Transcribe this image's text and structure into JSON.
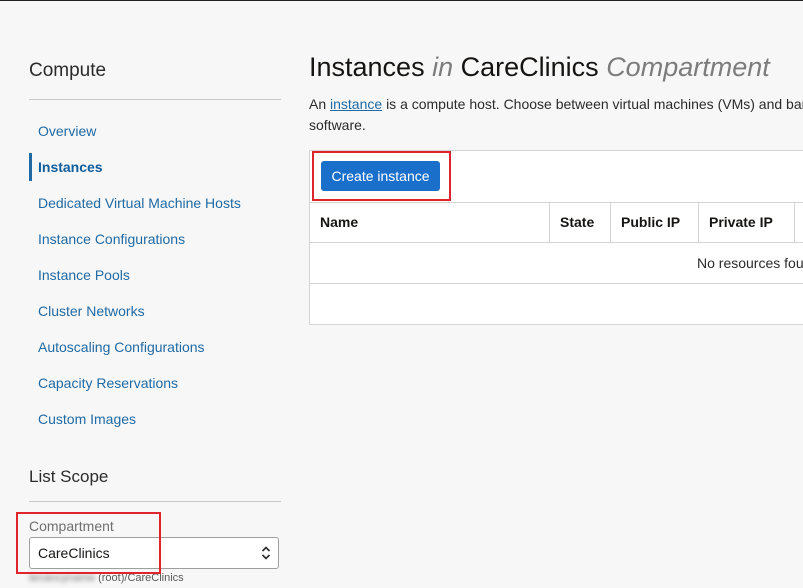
{
  "sidebar": {
    "title": "Compute",
    "items": [
      {
        "label": "Overview"
      },
      {
        "label": "Instances"
      },
      {
        "label": "Dedicated Virtual Machine Hosts"
      },
      {
        "label": "Instance Configurations"
      },
      {
        "label": "Instance Pools"
      },
      {
        "label": "Cluster Networks"
      },
      {
        "label": "Autoscaling Configurations"
      },
      {
        "label": "Capacity Reservations"
      },
      {
        "label": "Custom Images"
      }
    ],
    "active_item": "Instances",
    "list_scope": {
      "title": "List Scope",
      "compartment_label": "Compartment",
      "compartment_value": "CareClinics",
      "path_blurred": "tenancyname",
      "path_suffix": "(root)/CareClinics"
    }
  },
  "main": {
    "title_part1": "Instances",
    "title_in": "in",
    "title_compartment": "CareClinics",
    "title_part2": "Compartment",
    "desc_prefix": "An",
    "desc_link": "instance",
    "desc_line1_rest": "is a compute host. Choose between virtual machines (VMs) and bare metal instances",
    "desc_line2": "software.",
    "create_button": "Create instance",
    "table": {
      "columns": [
        "Name",
        "State",
        "Public IP",
        "Private IP"
      ],
      "empty_message": "No resources found."
    }
  },
  "colors": {
    "accent": "#1a6fcb",
    "link": "#1f6aa5",
    "highlight_box": "#e0242b"
  },
  "icons": {
    "select_arrow": "chevron-up-down-icon"
  }
}
